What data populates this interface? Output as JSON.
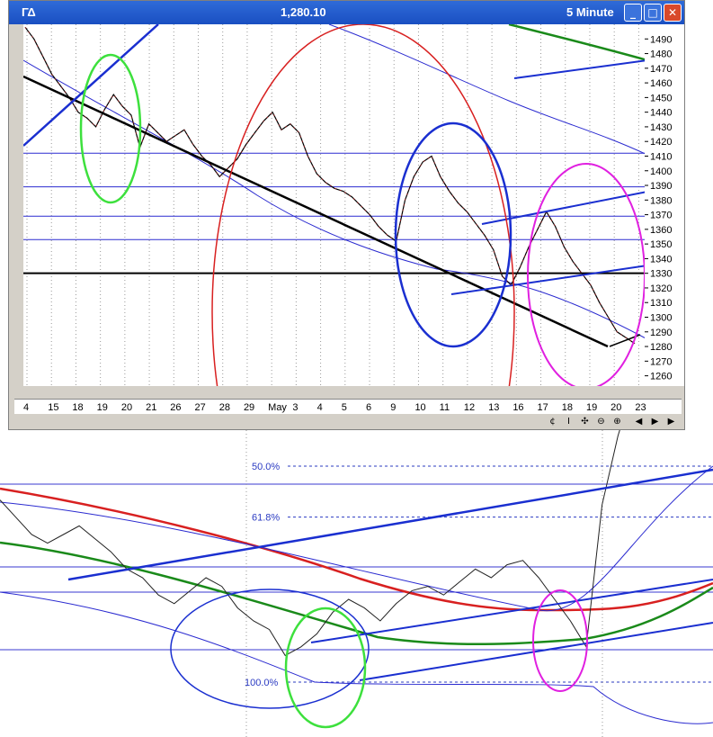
{
  "window": {
    "symbol": "ΓΔ",
    "last_price": "1,280.10",
    "interval": "5 Minute",
    "buttons": [
      "minimize",
      "maximize",
      "close"
    ]
  },
  "status_icons": [
    "reset-icon",
    "cursor-icon",
    "crosshair-icon",
    "zoom-out-icon",
    "zoom-in-icon",
    "scroll-left-icon",
    "scroll-right-icon"
  ],
  "chart_data": [
    {
      "type": "line",
      "title": "",
      "y_ticks": [
        1490,
        1480,
        1470,
        1460,
        1450,
        1440,
        1430,
        1420,
        1410,
        1400,
        1390,
        1380,
        1370,
        1360,
        1350,
        1340,
        1330,
        1320,
        1310,
        1300,
        1290,
        1280,
        1270,
        1260
      ],
      "ylim": [
        1253,
        1500
      ],
      "x_ticks": [
        "4",
        "15",
        "18",
        "19",
        "20",
        "21",
        "26",
        "27",
        "28",
        "29",
        "May",
        "3",
        "4",
        "5",
        "6",
        "9",
        "10",
        "11",
        "12",
        "13",
        "16",
        "17",
        "18",
        "19",
        "20",
        "23"
      ],
      "series": [
        {
          "values": [
            1498,
            1490,
            1478,
            1466,
            1458,
            1450,
            1440,
            1436,
            1430,
            1442,
            1452,
            1444,
            1438,
            1416,
            1432,
            1426,
            1420,
            1424,
            1428,
            1418,
            1410,
            1404,
            1396,
            1402,
            1408,
            1418,
            1426,
            1434,
            1440,
            1428,
            1432,
            1426,
            1410,
            1398,
            1392,
            1388,
            1386,
            1382,
            1376,
            1370,
            1362,
            1356,
            1352,
            1380,
            1396,
            1406,
            1410,
            1396,
            1386,
            1378,
            1372,
            1364,
            1356,
            1346,
            1328,
            1322,
            1334,
            1348,
            1360,
            1372,
            1362,
            1348,
            1338,
            1330,
            1322,
            1310,
            1300,
            1290,
            1286,
            1282
          ]
        }
      ],
      "horizontal_levels": [
        1412,
        1389,
        1369,
        1353,
        1330
      ],
      "annotations": [
        "green-ellipse",
        "red-arc",
        "blue-circle",
        "magenta-ellipse",
        "black-trendline"
      ]
    },
    {
      "type": "line",
      "title": "",
      "fib_levels": [
        {
          "label": "50.0%",
          "value": 0.5
        },
        {
          "label": "61.8%",
          "value": 0.618
        },
        {
          "label": "100.0%",
          "value": 1.0
        }
      ],
      "series": [
        {
          "values": [
            0.62,
            0.66,
            0.7,
            0.72,
            0.7,
            0.68,
            0.71,
            0.74,
            0.78,
            0.8,
            0.84,
            0.86,
            0.83,
            0.8,
            0.82,
            0.87,
            0.9,
            0.92,
            0.98,
            0.96,
            0.93,
            0.88,
            0.85,
            0.87,
            0.9,
            0.86,
            0.83,
            0.82,
            0.84,
            0.81,
            0.78,
            0.8,
            0.77,
            0.76,
            0.8,
            0.85,
            0.9,
            0.96,
            0.84,
            0.68,
            0.56,
            0.5,
            0.52,
            0.54,
            0.53,
            0.55
          ]
        }
      ],
      "annotations": [
        "blue-ellipse",
        "green-ellipse",
        "magenta-ellipse",
        "blue-channel"
      ]
    }
  ]
}
